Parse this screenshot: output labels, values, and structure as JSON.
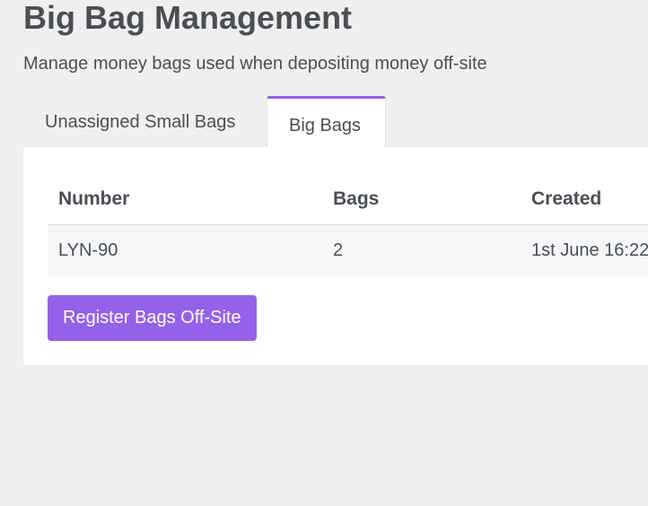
{
  "header": {
    "title": "Big Bag Management",
    "subtitle": "Manage money bags used when depositing money off-site"
  },
  "tabs": [
    {
      "label": "Unassigned Small Bags",
      "active": false
    },
    {
      "label": "Big Bags",
      "active": true
    }
  ],
  "table": {
    "columns": [
      "Number",
      "Bags",
      "Created"
    ],
    "rows": [
      {
        "number": "LYN-90",
        "bags": "2",
        "created": "1st June 16:22"
      }
    ]
  },
  "actions": {
    "register_label": "Register Bags Off-Site"
  },
  "colors": {
    "accent": "#9561e8",
    "background": "#efefef",
    "panel": "#ffffff",
    "row_background": "#f6f7f8",
    "text": "#4a4f55"
  }
}
